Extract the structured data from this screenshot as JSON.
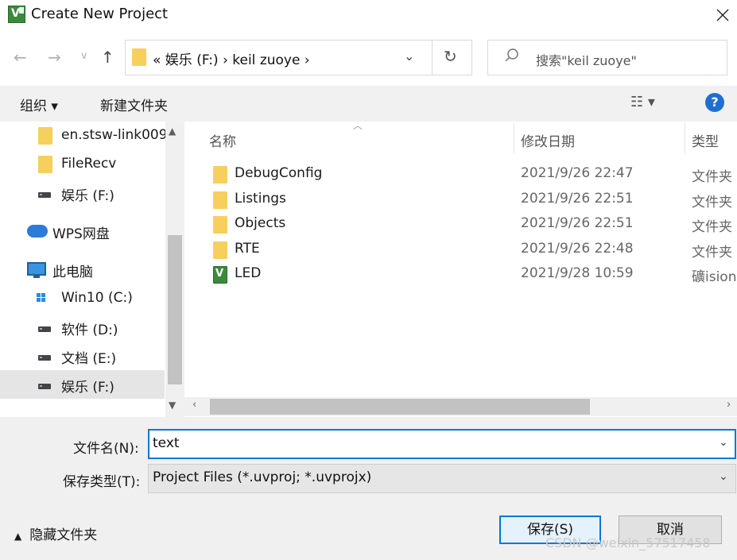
{
  "window": {
    "title": "Create New Project",
    "app_icon": "uvision-icon",
    "close_icon": "close-icon"
  },
  "nav": {
    "back_icon": "arrow-left-icon",
    "forward_icon": "arrow-right-icon",
    "recent_icon": "chevron-down-icon",
    "up_icon": "arrow-up-icon",
    "address": "« 娱乐 (F:)  ›  keil zuoye  ›",
    "refresh_icon": "refresh-icon",
    "search_placeholder": "搜索\"keil zuoye\""
  },
  "toolbar": {
    "organize": "组织 ▾",
    "new_folder": "新建文件夹",
    "view_icon": "view-options-icon",
    "help": "?"
  },
  "sidebar": {
    "items": [
      {
        "label": "en.stsw-link009",
        "icon": "folder-icon"
      },
      {
        "label": "FileRecv",
        "icon": "folder-icon"
      },
      {
        "label": "娱乐 (F:)",
        "icon": "drive-icon"
      },
      {
        "label": "WPS网盘",
        "icon": "cloud-icon"
      },
      {
        "label": "此电脑",
        "icon": "computer-icon"
      },
      {
        "label": "Win10 (C:)",
        "icon": "windows-drive-icon"
      },
      {
        "label": "软件 (D:)",
        "icon": "drive-icon"
      },
      {
        "label": "文档 (E:)",
        "icon": "drive-icon"
      },
      {
        "label": "娱乐 (F:)",
        "icon": "drive-icon",
        "selected": true
      }
    ]
  },
  "filelist": {
    "columns": {
      "name": "名称",
      "modified": "修改日期",
      "type": "类型"
    },
    "rows": [
      {
        "name": "DebugConfig",
        "modified": "2021/9/26 22:47",
        "type": "文件夹",
        "icon": "folder-icon"
      },
      {
        "name": "Listings",
        "modified": "2021/9/26 22:51",
        "type": "文件夹",
        "icon": "folder-icon"
      },
      {
        "name": "Objects",
        "modified": "2021/9/26 22:51",
        "type": "文件夹",
        "icon": "folder-icon"
      },
      {
        "name": "RTE",
        "modified": "2021/9/26 22:48",
        "type": "文件夹",
        "icon": "folder-icon"
      },
      {
        "name": "LED",
        "modified": "2021/9/28 10:59",
        "type": "礦ision",
        "icon": "uvision-icon"
      }
    ]
  },
  "form": {
    "filename_label": "文件名(N):",
    "filename_value": "text",
    "filetype_label": "保存类型(T):",
    "filetype_value": "Project Files (*.uvproj; *.uvprojx)"
  },
  "footer": {
    "hide_folders": "隐藏文件夹",
    "save": "保存(S)",
    "cancel": "取消"
  },
  "watermark": "CSDN @weixin_57517458",
  "colors": {
    "accent": "#0078d7",
    "folder": "#f7cf5d",
    "toolbar_bg": "#f1f1f1"
  }
}
